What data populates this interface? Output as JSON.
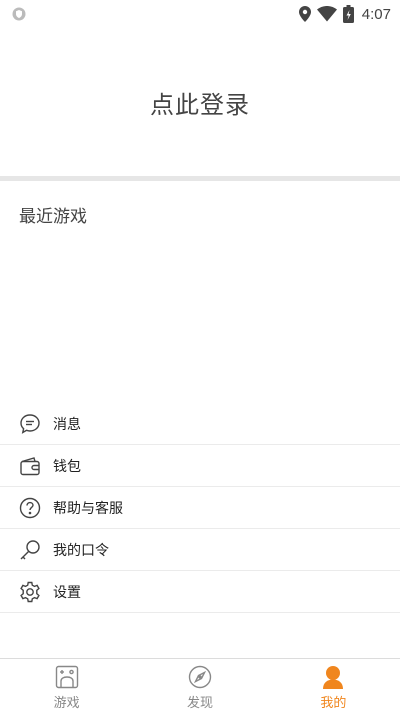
{
  "status_bar": {
    "time": "4:07",
    "icons": [
      "shield-icon",
      "location-icon",
      "wifi-icon",
      "battery-icon"
    ]
  },
  "login": {
    "label": "点此登录"
  },
  "recent": {
    "title": "最近游戏"
  },
  "menu": {
    "items": [
      {
        "label": "消息",
        "icon": "message-icon"
      },
      {
        "label": "钱包",
        "icon": "wallet-icon"
      },
      {
        "label": "帮助与客服",
        "icon": "help-icon"
      },
      {
        "label": "我的口令",
        "icon": "key-icon"
      },
      {
        "label": "设置",
        "icon": "settings-icon"
      }
    ]
  },
  "tabs": [
    {
      "label": "游戏",
      "icon": "game-icon",
      "active": false
    },
    {
      "label": "发现",
      "icon": "compass-icon",
      "active": false
    },
    {
      "label": "我的",
      "icon": "profile-icon",
      "active": true
    }
  ],
  "colors": {
    "accent": "#f0861e",
    "divider": "#e6e6e6",
    "inactive_tab": "#888888"
  }
}
